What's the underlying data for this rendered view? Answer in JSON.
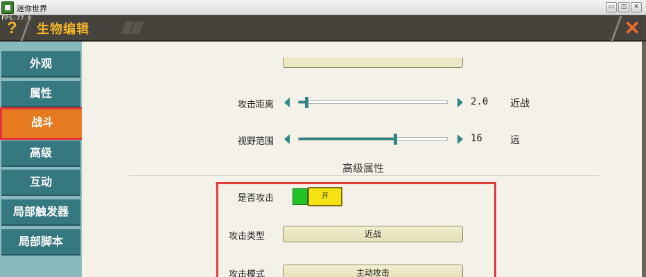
{
  "window": {
    "title": "迷你世界",
    "buttons": {
      "minimize": "▭",
      "restore": "◫",
      "close": "✕"
    }
  },
  "header": {
    "fps": "FPS:77.0",
    "help": "?",
    "title": "生物编辑",
    "close": "✕"
  },
  "sidebar": {
    "items": [
      {
        "label": "外观",
        "active": false
      },
      {
        "label": "属性",
        "active": false
      },
      {
        "label": "战斗",
        "active": true
      },
      {
        "label": "高级",
        "active": false
      },
      {
        "label": "互动",
        "active": false
      },
      {
        "label": "局部触发器",
        "active": false
      },
      {
        "label": "局部脚本",
        "active": false
      }
    ]
  },
  "sliders": [
    {
      "label": "攻击距离",
      "value": "2.0",
      "unit": "近战",
      "level": 0.05
    },
    {
      "label": "视野范围",
      "value": "16",
      "unit": "远",
      "level": 0.65
    }
  ],
  "advanced": {
    "title": "高级属性",
    "attack_toggle": {
      "label": "是否攻击",
      "state": "开"
    },
    "attack_type": {
      "label": "攻击类型",
      "value": "近战"
    },
    "attack_mode": {
      "label": "攻击模式",
      "value": "主动攻击"
    }
  },
  "colors": {
    "accent": "#f3b32a",
    "teal": "#2d8688",
    "highlight": "#e03a3a",
    "active_tab": "#e57a21"
  }
}
